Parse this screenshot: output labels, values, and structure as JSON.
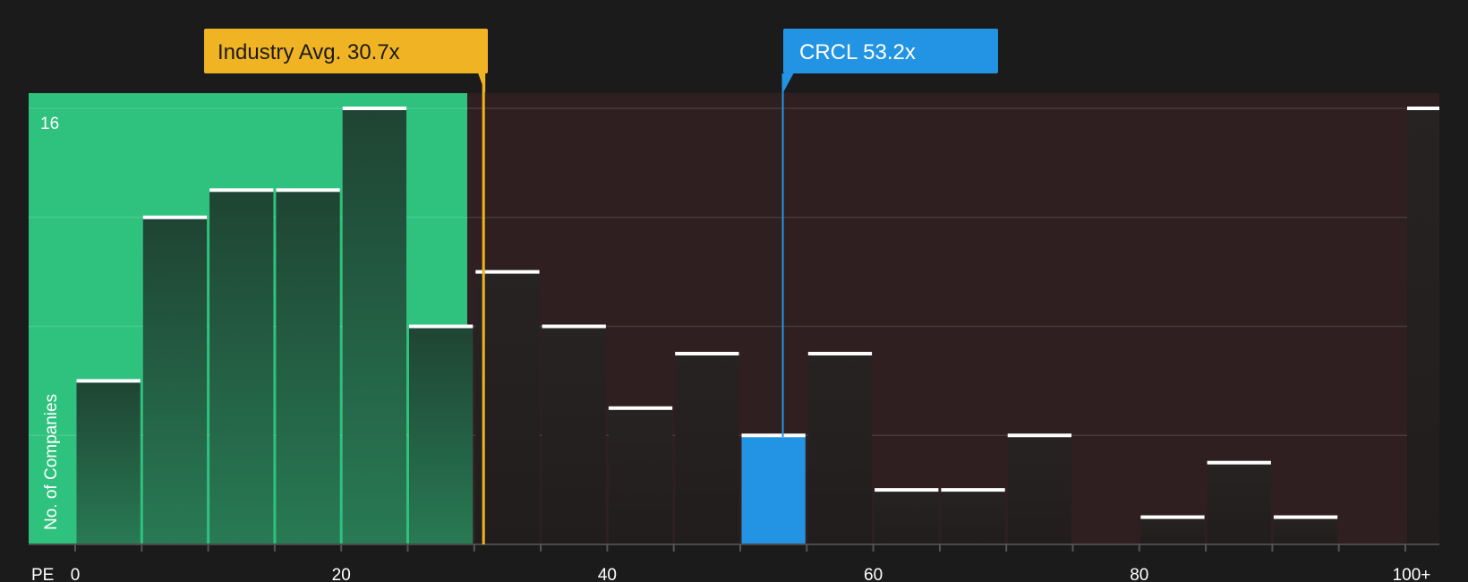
{
  "chart_data": {
    "type": "bar",
    "x_axis_name": "PE",
    "ylabel": "No. of Companies",
    "y_tick_label": "16",
    "ylim": [
      0,
      16
    ],
    "x_ticks": [
      "0",
      "20",
      "40",
      "60",
      "80",
      "100+"
    ],
    "bin_width": 5,
    "bins": [
      {
        "start": 0,
        "count": 6
      },
      {
        "start": 5,
        "count": 12
      },
      {
        "start": 10,
        "count": 13
      },
      {
        "start": 15,
        "count": 13
      },
      {
        "start": 20,
        "count": 16
      },
      {
        "start": 25,
        "count": 8
      },
      {
        "start": 30,
        "count": 10
      },
      {
        "start": 35,
        "count": 8
      },
      {
        "start": 40,
        "count": 5
      },
      {
        "start": 45,
        "count": 7
      },
      {
        "start": 50,
        "count": 4,
        "highlight": true
      },
      {
        "start": 55,
        "count": 7
      },
      {
        "start": 60,
        "count": 2
      },
      {
        "start": 65,
        "count": 2
      },
      {
        "start": 70,
        "count": 4
      },
      {
        "start": 80,
        "count": 1
      },
      {
        "start": 85,
        "count": 3
      },
      {
        "start": 90,
        "count": 1
      },
      {
        "start": 100,
        "count": 16
      }
    ],
    "industry_avg": {
      "label": "Industry Avg. 30.7x",
      "value": 30.7
    },
    "company": {
      "label": "CRCL 53.2x",
      "value": 53.2
    },
    "colors": {
      "background": "#1b1b1b",
      "undervalued_zone": "#2ec27e",
      "overvalued_zone": "#2f1f20",
      "bar_in_green": "#214a37",
      "bar_default": "#252222",
      "highlight_bar": "#2394e3",
      "industry_marker": "#f0b323",
      "company_marker": "#2394e3",
      "bar_cap": "#ffffff"
    }
  }
}
